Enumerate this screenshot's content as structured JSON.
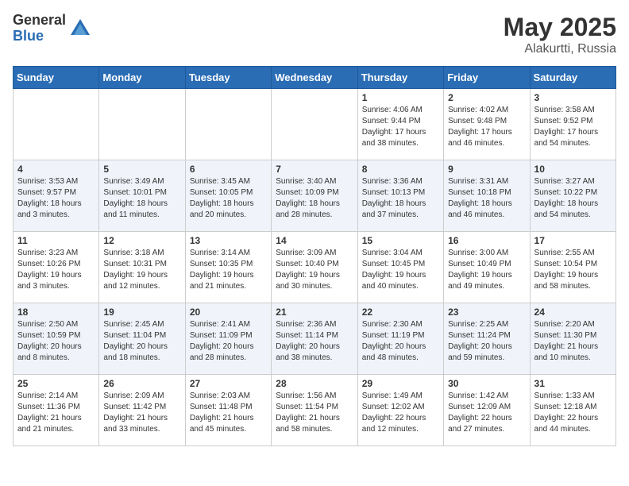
{
  "header": {
    "logo_general": "General",
    "logo_blue": "Blue",
    "title": "May 2025",
    "location": "Alakurtti, Russia"
  },
  "days_of_week": [
    "Sunday",
    "Monday",
    "Tuesday",
    "Wednesday",
    "Thursday",
    "Friday",
    "Saturday"
  ],
  "weeks": [
    [
      {
        "day": "",
        "info": ""
      },
      {
        "day": "",
        "info": ""
      },
      {
        "day": "",
        "info": ""
      },
      {
        "day": "",
        "info": ""
      },
      {
        "day": "1",
        "info": "Sunrise: 4:06 AM\nSunset: 9:44 PM\nDaylight: 17 hours\nand 38 minutes."
      },
      {
        "day": "2",
        "info": "Sunrise: 4:02 AM\nSunset: 9:48 PM\nDaylight: 17 hours\nand 46 minutes."
      },
      {
        "day": "3",
        "info": "Sunrise: 3:58 AM\nSunset: 9:52 PM\nDaylight: 17 hours\nand 54 minutes."
      }
    ],
    [
      {
        "day": "4",
        "info": "Sunrise: 3:53 AM\nSunset: 9:57 PM\nDaylight: 18 hours\nand 3 minutes."
      },
      {
        "day": "5",
        "info": "Sunrise: 3:49 AM\nSunset: 10:01 PM\nDaylight: 18 hours\nand 11 minutes."
      },
      {
        "day": "6",
        "info": "Sunrise: 3:45 AM\nSunset: 10:05 PM\nDaylight: 18 hours\nand 20 minutes."
      },
      {
        "day": "7",
        "info": "Sunrise: 3:40 AM\nSunset: 10:09 PM\nDaylight: 18 hours\nand 28 minutes."
      },
      {
        "day": "8",
        "info": "Sunrise: 3:36 AM\nSunset: 10:13 PM\nDaylight: 18 hours\nand 37 minutes."
      },
      {
        "day": "9",
        "info": "Sunrise: 3:31 AM\nSunset: 10:18 PM\nDaylight: 18 hours\nand 46 minutes."
      },
      {
        "day": "10",
        "info": "Sunrise: 3:27 AM\nSunset: 10:22 PM\nDaylight: 18 hours\nand 54 minutes."
      }
    ],
    [
      {
        "day": "11",
        "info": "Sunrise: 3:23 AM\nSunset: 10:26 PM\nDaylight: 19 hours\nand 3 minutes."
      },
      {
        "day": "12",
        "info": "Sunrise: 3:18 AM\nSunset: 10:31 PM\nDaylight: 19 hours\nand 12 minutes."
      },
      {
        "day": "13",
        "info": "Sunrise: 3:14 AM\nSunset: 10:35 PM\nDaylight: 19 hours\nand 21 minutes."
      },
      {
        "day": "14",
        "info": "Sunrise: 3:09 AM\nSunset: 10:40 PM\nDaylight: 19 hours\nand 30 minutes."
      },
      {
        "day": "15",
        "info": "Sunrise: 3:04 AM\nSunset: 10:45 PM\nDaylight: 19 hours\nand 40 minutes."
      },
      {
        "day": "16",
        "info": "Sunrise: 3:00 AM\nSunset: 10:49 PM\nDaylight: 19 hours\nand 49 minutes."
      },
      {
        "day": "17",
        "info": "Sunrise: 2:55 AM\nSunset: 10:54 PM\nDaylight: 19 hours\nand 58 minutes."
      }
    ],
    [
      {
        "day": "18",
        "info": "Sunrise: 2:50 AM\nSunset: 10:59 PM\nDaylight: 20 hours\nand 8 minutes."
      },
      {
        "day": "19",
        "info": "Sunrise: 2:45 AM\nSunset: 11:04 PM\nDaylight: 20 hours\nand 18 minutes."
      },
      {
        "day": "20",
        "info": "Sunrise: 2:41 AM\nSunset: 11:09 PM\nDaylight: 20 hours\nand 28 minutes."
      },
      {
        "day": "21",
        "info": "Sunrise: 2:36 AM\nSunset: 11:14 PM\nDaylight: 20 hours\nand 38 minutes."
      },
      {
        "day": "22",
        "info": "Sunrise: 2:30 AM\nSunset: 11:19 PM\nDaylight: 20 hours\nand 48 minutes."
      },
      {
        "day": "23",
        "info": "Sunrise: 2:25 AM\nSunset: 11:24 PM\nDaylight: 20 hours\nand 59 minutes."
      },
      {
        "day": "24",
        "info": "Sunrise: 2:20 AM\nSunset: 11:30 PM\nDaylight: 21 hours\nand 10 minutes."
      }
    ],
    [
      {
        "day": "25",
        "info": "Sunrise: 2:14 AM\nSunset: 11:36 PM\nDaylight: 21 hours\nand 21 minutes."
      },
      {
        "day": "26",
        "info": "Sunrise: 2:09 AM\nSunset: 11:42 PM\nDaylight: 21 hours\nand 33 minutes."
      },
      {
        "day": "27",
        "info": "Sunrise: 2:03 AM\nSunset: 11:48 PM\nDaylight: 21 hours\nand 45 minutes."
      },
      {
        "day": "28",
        "info": "Sunrise: 1:56 AM\nSunset: 11:54 PM\nDaylight: 21 hours\nand 58 minutes."
      },
      {
        "day": "29",
        "info": "Sunrise: 1:49 AM\nSunset: 12:02 AM\nDaylight: 22 hours\nand 12 minutes."
      },
      {
        "day": "30",
        "info": "Sunrise: 1:42 AM\nSunset: 12:09 AM\nDaylight: 22 hours\nand 27 minutes."
      },
      {
        "day": "31",
        "info": "Sunrise: 1:33 AM\nSunset: 12:18 AM\nDaylight: 22 hours\nand 44 minutes."
      }
    ]
  ]
}
